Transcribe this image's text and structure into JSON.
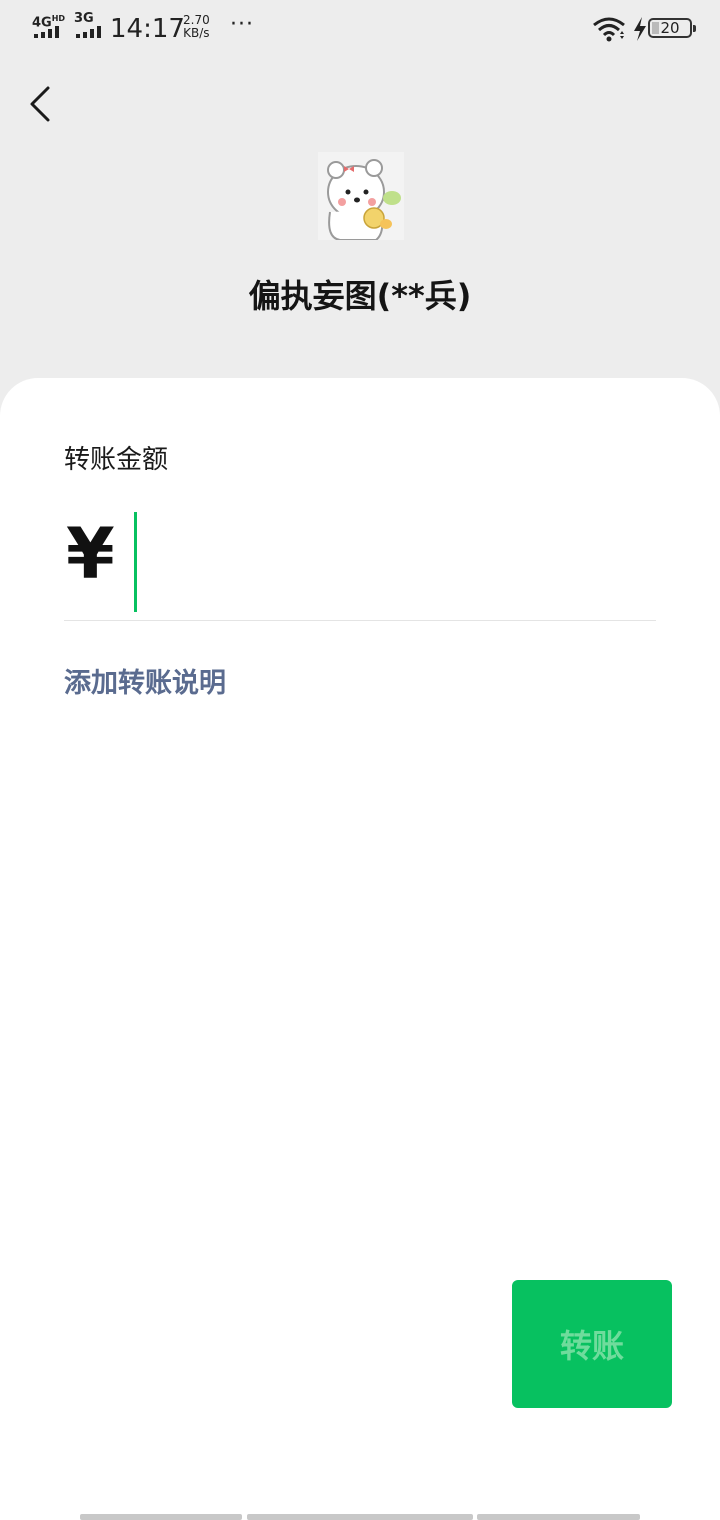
{
  "status_bar": {
    "network_1": "4G",
    "network_1_sup": "HD",
    "network_2": "3G",
    "time": "14:17",
    "speed_value": "2.70",
    "speed_unit": "KB/s",
    "more": "···",
    "battery": "20",
    "battery_level": 0.2,
    "icons": [
      "signal-bars-icon",
      "wifi-icon",
      "charging-icon",
      "battery-icon"
    ]
  },
  "header": {
    "back_icon": "chevron-left-icon",
    "payee_name": "偏执妄图(**兵)"
  },
  "form": {
    "amount_label": "转账金额",
    "currency_symbol": "¥",
    "amount_value": "",
    "add_note_label": "添加转账说明"
  },
  "actions": {
    "transfer_label": "转账"
  },
  "colors": {
    "accent": "#07c160",
    "link": "#5a6b8f",
    "background": "#ededed",
    "card": "#ffffff"
  }
}
